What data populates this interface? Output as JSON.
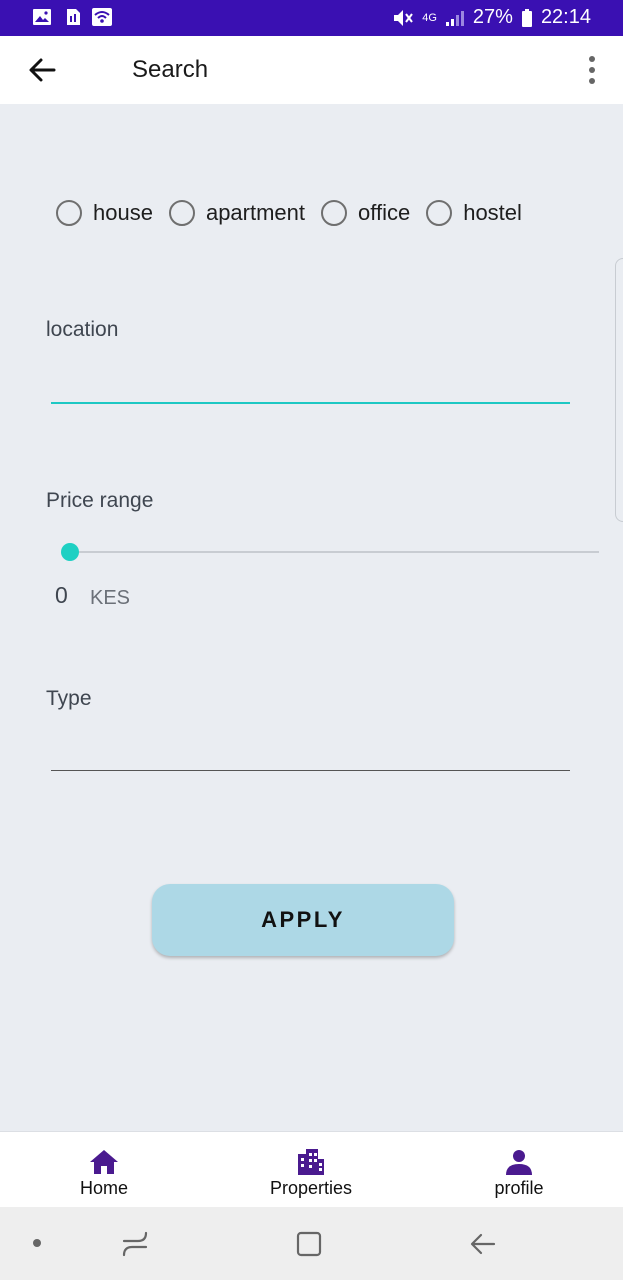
{
  "status_bar": {
    "battery": "27%",
    "time": "22:14",
    "network": "4G"
  },
  "app_bar": {
    "title": "Search"
  },
  "property_kinds": [
    {
      "label": "house"
    },
    {
      "label": "apartment"
    },
    {
      "label": "office"
    },
    {
      "label": "hostel"
    }
  ],
  "location": {
    "label": "location",
    "value": ""
  },
  "price_range": {
    "label": "Price range",
    "value": "0",
    "unit": "KES",
    "slider_level": 0
  },
  "type": {
    "label": "Type",
    "value": ""
  },
  "apply_label": "APPLY",
  "bottom_nav": {
    "items": [
      {
        "label": "Home",
        "icon": "home-icon"
      },
      {
        "label": "Properties",
        "icon": "building-icon"
      },
      {
        "label": "profile",
        "icon": "person-icon"
      }
    ]
  },
  "colors": {
    "status_bar": "#3a10b2",
    "accent": "#1ec8c4",
    "button": "#add8e6",
    "nav_icon": "#4a1a8f",
    "background": "#eaedf2"
  }
}
